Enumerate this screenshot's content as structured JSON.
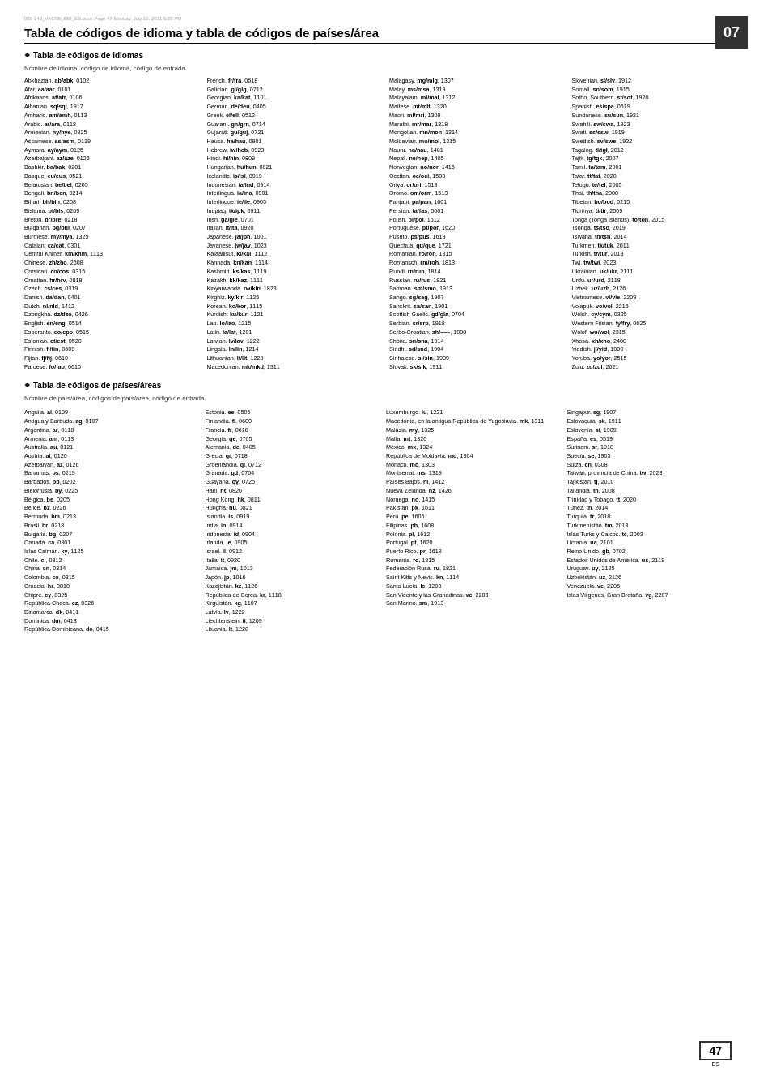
{
  "page": {
    "chapter": "07",
    "page_number": "47",
    "page_lang": "ES",
    "file_info": "000-140_VXCN5_IBD_ES.book  Page 47  Monday, July 11, 2011  5:29 PM"
  },
  "title": "Tabla de códigos de idioma y tabla de códigos de países/área",
  "section_languages": {
    "header": "Tabla de códigos de idiomas",
    "subtitle": "Nombre de idioma, código de idioma, código de entrada",
    "entries": [
      {
        "name": "Abkhazian",
        "code": "ab/abk, 0102"
      },
      {
        "name": "Afar",
        "code": "aa/aar, 0101"
      },
      {
        "name": "Afrikaans",
        "code": "af/afr, 0106"
      },
      {
        "name": "Albanian",
        "code": "sq/sqi, 1917"
      },
      {
        "name": "Amharic",
        "code": "am/amh, 0113"
      },
      {
        "name": "Arabic",
        "code": "ar/ara, 0118"
      },
      {
        "name": "Armenian",
        "code": "hy/hye, 0825"
      },
      {
        "name": "Assamese",
        "code": "as/asm, 0119"
      },
      {
        "name": "Aymara",
        "code": "ay/aym, 0125"
      },
      {
        "name": "Azerbaijani",
        "code": "az/aze, 0126"
      },
      {
        "name": "Bashkir",
        "code": "ba/bak, 0201"
      },
      {
        "name": "Basque",
        "code": "eu/eus, 0521"
      },
      {
        "name": "Belarusian",
        "code": "be/bel, 0205"
      },
      {
        "name": "Bengali",
        "code": "bn/ben, 0214"
      },
      {
        "name": "Bihari",
        "code": "bh/bih, 0208"
      },
      {
        "name": "Bislama",
        "code": "bi/bis, 0209"
      },
      {
        "name": "Breton",
        "code": "br/bre, 0218"
      },
      {
        "name": "Bulgarian",
        "code": "bg/bul, 0207"
      },
      {
        "name": "Burmese",
        "code": "my/mya, 1325"
      },
      {
        "name": "Catalan",
        "code": "ca/cat, 0301"
      },
      {
        "name": "Central Khmer",
        "code": "km/khm, 1113"
      },
      {
        "name": "Chinese",
        "code": "zh/zho, 2608"
      },
      {
        "name": "Corsican",
        "code": "co/cos, 0315"
      },
      {
        "name": "Croatian",
        "code": "hr/hrv, 0818"
      },
      {
        "name": "Czech",
        "code": "cs/ces, 0319"
      },
      {
        "name": "Danish",
        "code": "da/dan, 0401"
      },
      {
        "name": "Dutch",
        "code": "nl/nld, 1412"
      },
      {
        "name": "Dzongkha",
        "code": "dz/dzo, 0426"
      },
      {
        "name": "English",
        "code": "en/eng, 0514"
      },
      {
        "name": "Esperanto",
        "code": "eo/epo, 0515"
      },
      {
        "name": "Estonian",
        "code": "et/est, 0520"
      },
      {
        "name": "Finnish",
        "code": "fi/fin, 0609"
      },
      {
        "name": "Fijian",
        "code": "fj/fij, 0610"
      },
      {
        "name": "Faroese",
        "code": "fo/fao, 0615"
      }
    ],
    "col2": [
      {
        "name": "French",
        "code": "fr/fra, 0618"
      },
      {
        "name": "Galician",
        "code": "gl/glg, 0712"
      },
      {
        "name": "Georgian",
        "code": "ka/kat, 1101"
      },
      {
        "name": "German",
        "code": "de/deu, 0405"
      },
      {
        "name": "Greek",
        "code": "el/ell, 0512"
      },
      {
        "name": "Guaraní",
        "code": "gn/grn, 0714"
      },
      {
        "name": "Gujarati",
        "code": "gu/guj, 0721"
      },
      {
        "name": "Hausa",
        "code": "ha/hau, 0801"
      },
      {
        "name": "Hebrew",
        "code": "iw/heb, 0923"
      },
      {
        "name": "Hindi",
        "code": "hi/hin, 0809"
      },
      {
        "name": "Hungarian",
        "code": "hu/hun, 0821"
      },
      {
        "name": "Icelandic",
        "code": "is/isl, 0919"
      },
      {
        "name": "Indonesian",
        "code": "ia/ind, 0914"
      },
      {
        "name": "Interlingua",
        "code": "ia/ina, 0901"
      },
      {
        "name": "Interlingue",
        "code": "ie/ile, 0905"
      },
      {
        "name": "Inupiaq",
        "code": "ik/ipk, 0911"
      },
      {
        "name": "Irish",
        "code": "ga/gle, 0701"
      },
      {
        "name": "Italian",
        "code": "it/ita, 0920"
      },
      {
        "name": "Japanese",
        "code": "ja/jpn, 1001"
      },
      {
        "name": "Javanese",
        "code": "jw/jav, 1023"
      },
      {
        "name": "Kalaallisut",
        "code": "kl/kal, 1112"
      },
      {
        "name": "Kannada",
        "code": "kn/kan, 1114"
      },
      {
        "name": "Kashmiri",
        "code": "ks/kas, 1119"
      },
      {
        "name": "Kazakh",
        "code": "kk/kaz, 1111"
      },
      {
        "name": "Kinyarwanda",
        "code": "rw/kin, 1823"
      },
      {
        "name": "Kirghiz",
        "code": "ky/kir, 1125"
      },
      {
        "name": "Korean",
        "code": "ko/kor, 1115"
      },
      {
        "name": "Kurdish",
        "code": "ku/kur, 1121"
      },
      {
        "name": "Lao",
        "code": "lo/lao, 1215"
      },
      {
        "name": "Latin",
        "code": "la/lat, 1201"
      },
      {
        "name": "Latvian",
        "code": "lv/lav, 1222"
      },
      {
        "name": "Lingala",
        "code": "ln/lin, 1214"
      },
      {
        "name": "Lithuanian",
        "code": "lt/lit, 1220"
      },
      {
        "name": "Macedonian",
        "code": "mk/mkd, 1311"
      }
    ],
    "col3": [
      {
        "name": "Malagasy",
        "code": "mg/mlg, 1307"
      },
      {
        "name": "Malay",
        "code": "ms/msa, 1319"
      },
      {
        "name": "Malayalam",
        "code": "ml/mal, 1312"
      },
      {
        "name": "Maltese",
        "code": "mt/mlt, 1320"
      },
      {
        "name": "Maori",
        "code": "mi/mri, 1309"
      },
      {
        "name": "Marathi",
        "code": "mr/mar, 1318"
      },
      {
        "name": "Mongolian",
        "code": "mn/mon, 1314"
      },
      {
        "name": "Moldavian",
        "code": "mo/mol, 1315"
      },
      {
        "name": "Nauru",
        "code": "na/nau, 1401"
      },
      {
        "name": "Nepali",
        "code": "ne/nep, 1405"
      },
      {
        "name": "Norwegian",
        "code": "no/nor, 1415"
      },
      {
        "name": "Occitan",
        "code": "oc/oci, 1503"
      },
      {
        "name": "Oriya",
        "code": "or/ori, 1518"
      },
      {
        "name": "Oromo",
        "code": "om/orm, 1513"
      },
      {
        "name": "Panjabi",
        "code": "pa/pan, 1601"
      },
      {
        "name": "Persian",
        "code": "fa/fas, 0601"
      },
      {
        "name": "Polish",
        "code": "pl/pol, 1612"
      },
      {
        "name": "Portuguese",
        "code": "pt/por, 1620"
      },
      {
        "name": "Pushto",
        "code": "ps/pus, 1619"
      },
      {
        "name": "Quechua",
        "code": "qu/que, 1721"
      },
      {
        "name": "Romanian",
        "code": "ro/ron, 1815"
      },
      {
        "name": "Romansch",
        "code": "rm/roh, 1813"
      },
      {
        "name": "Rundi",
        "code": "rn/run, 1814"
      },
      {
        "name": "Russian",
        "code": "ru/rus, 1821"
      },
      {
        "name": "Samoan",
        "code": "sm/smo, 1913"
      },
      {
        "name": "Sango",
        "code": "sg/sag, 1907"
      },
      {
        "name": "Sanskrit",
        "code": "sa/san, 1901"
      },
      {
        "name": "Scottish Gaelic",
        "code": "gd/gla, 0704"
      },
      {
        "name": "Serbian",
        "code": "sr/srp, 1918"
      },
      {
        "name": "Serbo-Croatian",
        "code": "sh/–––, 1908"
      },
      {
        "name": "Shona",
        "code": "sn/sna, 1914"
      },
      {
        "name": "Sindhi",
        "code": "sd/snd, 1904"
      },
      {
        "name": "Sinhalese",
        "code": "si/sin, 1909"
      },
      {
        "name": "Slovak",
        "code": "sk/slk, 1911"
      }
    ],
    "col4": [
      {
        "name": "Slovenian",
        "code": "sl/slv, 1912"
      },
      {
        "name": "Somali",
        "code": "so/som, 1915"
      },
      {
        "name": "Sotho, Southern",
        "code": "st/sot, 1920"
      },
      {
        "name": "Spanish",
        "code": "es/spa, 0519"
      },
      {
        "name": "Sundanese",
        "code": "su/sun, 1921"
      },
      {
        "name": "Swahili",
        "code": "sw/swa, 1923"
      },
      {
        "name": "Swati",
        "code": "ss/ssw, 1919"
      },
      {
        "name": "Swedish",
        "code": "sv/swe, 1922"
      },
      {
        "name": "Tagalog",
        "code": "tl/tgl, 2012"
      },
      {
        "name": "Tajik",
        "code": "tg/tgk, 2007"
      },
      {
        "name": "Tamil",
        "code": "ta/tam, 2001"
      },
      {
        "name": "Tatar",
        "code": "tt/tat, 2020"
      },
      {
        "name": "Telugu",
        "code": "te/tel, 2005"
      },
      {
        "name": "Thai",
        "code": "th/tha, 2008"
      },
      {
        "name": "Tibetan",
        "code": "bo/bod, 0215"
      },
      {
        "name": "Tigrinya",
        "code": "ti/tir, 2009"
      },
      {
        "name": "Tonga (Tonga Islands)",
        "code": "to/ton, 2015"
      },
      {
        "name": "Tsonga",
        "code": "ts/tso, 2019"
      },
      {
        "name": "Tswana",
        "code": "tn/tsn, 2014"
      },
      {
        "name": "Turkmen",
        "code": "tk/tuk, 2011"
      },
      {
        "name": "Turkish",
        "code": "tr/tur, 2018"
      },
      {
        "name": "Twi",
        "code": "tw/twi, 2023"
      },
      {
        "name": "Ukrainian",
        "code": "uk/ukr, 2111"
      },
      {
        "name": "Urdu",
        "code": "ur/urd, 2118"
      },
      {
        "name": "Uzbek",
        "code": "uz/uzb, 2126"
      },
      {
        "name": "Vietnamese",
        "code": "vi/vie, 2209"
      },
      {
        "name": "Volapük",
        "code": "vo/vol, 2215"
      },
      {
        "name": "Welsh",
        "code": "cy/cym, 0325"
      },
      {
        "name": "Western Frisian",
        "code": "fy/fry, 0625"
      },
      {
        "name": "Wolof",
        "code": "wo/wol, 2315"
      },
      {
        "name": "Xhosa",
        "code": "xh/xho, 2408"
      },
      {
        "name": "Yiddish",
        "code": "ji/yid, 1009"
      },
      {
        "name": "Yoruba",
        "code": "yo/yor, 2515"
      },
      {
        "name": "Zulu",
        "code": "zu/zul, 2621"
      }
    ]
  },
  "section_countries": {
    "header": "Tabla de códigos de países/áreas",
    "subtitle": "Nombre de país/área, códigos de país/área, código de entrada",
    "col1": [
      {
        "name": "Anguila",
        "code": "ai, 0109"
      },
      {
        "name": "Antigua y Barbuda",
        "code": "ag, 0107"
      },
      {
        "name": "Argentina",
        "code": "ar, 0118"
      },
      {
        "name": "Armenia",
        "code": "am, 0113"
      },
      {
        "name": "Australia",
        "code": "au, 0121"
      },
      {
        "name": "Austria",
        "code": "at, 0120"
      },
      {
        "name": "Azerbaiyán",
        "code": "az, 0126"
      },
      {
        "name": "Bahamas",
        "code": "bs, 0219"
      },
      {
        "name": "Barbados",
        "code": "bb, 0202"
      },
      {
        "name": "Bielorrusia",
        "code": "by, 0225"
      },
      {
        "name": "Bélgica",
        "code": "be, 0205"
      },
      {
        "name": "Belice",
        "code": "bz, 0226"
      },
      {
        "name": "Bermuda",
        "code": "bm, 0213"
      },
      {
        "name": "Brasil",
        "code": "br, 0218"
      },
      {
        "name": "Bulgaria",
        "code": "bg, 0207"
      },
      {
        "name": "Canadá",
        "code": "ca, 0301"
      },
      {
        "name": "Islas Caimán",
        "code": "ky, 1125"
      },
      {
        "name": "Chile",
        "code": "cl, 0312"
      },
      {
        "name": "China",
        "code": "cn, 0314"
      },
      {
        "name": "Colombia",
        "code": "co, 0315"
      },
      {
        "name": "Croacia",
        "code": "hr, 0818"
      },
      {
        "name": "Chipre",
        "code": "cy, 0325"
      },
      {
        "name": "República Checa",
        "code": "cz, 0326"
      },
      {
        "name": "Dinamarca",
        "code": "dk, 0411"
      },
      {
        "name": "Dominica",
        "code": "dm, 0413"
      },
      {
        "name": "República Dominicana",
        "code": "do, 0415"
      }
    ],
    "col2": [
      {
        "name": "Estonia",
        "code": "ee, 0505"
      },
      {
        "name": "Finlandia",
        "code": "fi, 0609"
      },
      {
        "name": "Francia",
        "code": "fr, 0618"
      },
      {
        "name": "Georgia",
        "code": "ge, 0705"
      },
      {
        "name": "Alemania",
        "code": "de, 0405"
      },
      {
        "name": "Grecia",
        "code": "gr, 0718"
      },
      {
        "name": "Groenlandia",
        "code": "gl, 0712"
      },
      {
        "name": "Granada",
        "code": "gd, 0704"
      },
      {
        "name": "Guayana",
        "code": "gy, 0725"
      },
      {
        "name": "Haití",
        "code": "ht, 0820"
      },
      {
        "name": "Hong Kong",
        "code": "hk, 0811"
      },
      {
        "name": "Hungría",
        "code": "hu, 0821"
      },
      {
        "name": "Islandia",
        "code": "is, 0919"
      },
      {
        "name": "India",
        "code": "in, 0914"
      },
      {
        "name": "Indonesia",
        "code": "id, 0904"
      },
      {
        "name": "Irlanda",
        "code": "ie, 0905"
      },
      {
        "name": "Israel",
        "code": "il, 0912"
      },
      {
        "name": "Italia",
        "code": "it, 0920"
      },
      {
        "name": "Jamaica",
        "code": "jm, 1013"
      },
      {
        "name": "Japón",
        "code": "jp, 1016"
      },
      {
        "name": "Kazajistán",
        "code": "kz, 1126"
      },
      {
        "name": "República de Corea",
        "code": "kr, 1118"
      },
      {
        "name": "Kirguistán",
        "code": "kg, 1107"
      },
      {
        "name": "Latvia",
        "code": "lv, 1222"
      },
      {
        "name": "Liechtenstein",
        "code": "li, 1209"
      },
      {
        "name": "Lituania",
        "code": "lt, 1220"
      }
    ],
    "col3": [
      {
        "name": "Luxemburgo",
        "code": "lu, 1221"
      },
      {
        "name": "Macedonia, en la antigua República de Yugoslavia",
        "code": "mk, 1311"
      },
      {
        "name": "Malasia",
        "code": "my, 1325"
      },
      {
        "name": "Malta",
        "code": "mt, 1320"
      },
      {
        "name": "México",
        "code": "mx, 1324"
      },
      {
        "name": "República de Moldavia",
        "code": "md, 1304"
      },
      {
        "name": "Mónaco",
        "code": "mc, 1303"
      },
      {
        "name": "Montserrat",
        "code": "ms, 1319"
      },
      {
        "name": "Países Bajos",
        "code": "nl, 1412"
      },
      {
        "name": "Nueva Zelanda",
        "code": "nz, 1426"
      },
      {
        "name": "Noruega",
        "code": "no, 1415"
      },
      {
        "name": "Pakistán",
        "code": "pk, 1611"
      },
      {
        "name": "Perú",
        "code": "pe, 1605"
      },
      {
        "name": "Filipinas",
        "code": "ph, 1608"
      },
      {
        "name": "Polonia",
        "code": "pl, 1612"
      },
      {
        "name": "Portugal",
        "code": "pt, 1620"
      },
      {
        "name": "Puerto Rico",
        "code": "pr, 1618"
      },
      {
        "name": "Rumanía",
        "code": "ro, 1815"
      },
      {
        "name": "Federación Rusa",
        "code": "ru, 1821"
      },
      {
        "name": "Saint Kitts y Nevis",
        "code": "kn, 1114"
      },
      {
        "name": "Santa Lucía",
        "code": "lc, 1203"
      },
      {
        "name": "San Vicente y las Granadinas",
        "code": "vc, 2203"
      },
      {
        "name": "San Marino",
        "code": "sm, 1913"
      }
    ],
    "col4": [
      {
        "name": "Singapur",
        "code": "sg, 1907"
      },
      {
        "name": "Eslovaquia",
        "code": "sk, 1911"
      },
      {
        "name": "Eslovenia",
        "code": "si, 1909"
      },
      {
        "name": "España",
        "code": "es, 0519"
      },
      {
        "name": "Surinam",
        "code": "sr, 1918"
      },
      {
        "name": "Suecia",
        "code": "se, 1905"
      },
      {
        "name": "Suiza",
        "code": "ch, 0308"
      },
      {
        "name": "Taiwán, provincia de China",
        "code": "tw, 2023"
      },
      {
        "name": "Tajikistán",
        "code": "tj, 2010"
      },
      {
        "name": "Tailandia",
        "code": "th, 2008"
      },
      {
        "name": "Trinidad y Tobago",
        "code": "tt, 2020"
      },
      {
        "name": "Túnez",
        "code": "tn, 2014"
      },
      {
        "name": "Turquía",
        "code": "tr, 2018"
      },
      {
        "name": "Turkmenistán",
        "code": "tm, 2013"
      },
      {
        "name": "Islas Turks y Caicos",
        "code": "tc, 2003"
      },
      {
        "name": "Ucrania",
        "code": "ua, 2101"
      },
      {
        "name": "Reino Unido",
        "code": "gb, 0702"
      },
      {
        "name": "Estados Unidos de América",
        "code": "us, 2119"
      },
      {
        "name": "Uruguay",
        "code": "uy, 2125"
      },
      {
        "name": "Uzbekistán",
        "code": "uz, 2126"
      },
      {
        "name": "Venezuela",
        "code": "ve, 2205"
      },
      {
        "name": "Islas Vírgenes, Gran Bretaña",
        "code": "vg, 2207"
      }
    ]
  }
}
